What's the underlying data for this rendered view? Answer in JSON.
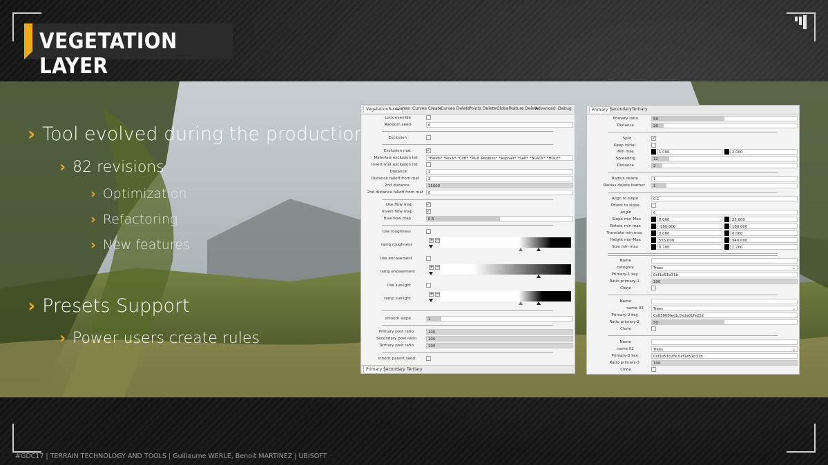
{
  "slide": {
    "title": "VEGETATION LAYER",
    "accent_color": "#f0a81e",
    "footer": "#GDC17 | TERRAIN TECHNOLOGY AND TOOLS | Guillaume WERLE, Benoit MARTINEZ | UBISOFT",
    "bullets": [
      {
        "level": 1,
        "text": "Tool evolved during the production"
      },
      {
        "level": 2,
        "text": "82 revisions"
      },
      {
        "level": 3,
        "text": "Optimization"
      },
      {
        "level": 3,
        "text": "Refactoring"
      },
      {
        "level": 3,
        "text": "New features"
      },
      {
        "level": 1,
        "text": "Presets Support"
      },
      {
        "level": 2,
        "text": "Power users create rules"
      }
    ]
  },
  "left_panel": {
    "tabs": [
      "VegetationRules",
      "Lianas",
      "Curves Create",
      "Curves Delete",
      "Points Delete",
      "GlobalNature Delete",
      "Advanced",
      "Debug"
    ],
    "active_tab": "VegetationRules",
    "bottom_tabs": [
      "Primary",
      "Secondary",
      "Tertiary"
    ],
    "active_bottom_tab": "Primary",
    "lock_override": "Lock override",
    "random_seed": {
      "label": "Random seed",
      "value": "0"
    },
    "exclusion": "Exclusion",
    "exclusion_mat": "Exclusion mat",
    "materials_exclusion_list": {
      "label": "Materials exclusion list",
      "value": "*Fields* *Rock* *Cliff* *Mud_Pebbles* *Asphalt* *Salt* *BLACK* *HOLE*"
    },
    "invert_mat_exclusion_list": "Invert mat exclusion list",
    "distance": {
      "label": "Distance",
      "value": "2"
    },
    "distance_falloff": {
      "label": "Distance falloff from mat",
      "value": "3"
    },
    "second_distance": {
      "label": "2nd distance",
      "value": "15000"
    },
    "second_distance_falloff": {
      "label": "2nd distance falloff from mat",
      "value": "0"
    },
    "use_flow_map": "Use flow map",
    "invert_flow_map": "Invert flow map",
    "bias_flow_map": {
      "label": "Bias flow map",
      "value": "0.5",
      "fraction": 0.5
    },
    "use_roughness": "Use roughness",
    "ramp_roughness": "ramp roughness",
    "use_encasement": "Use encasement",
    "ramp_encasement": "ramp encasement",
    "use_sunlight": "Use sunlight",
    "ramp_sunlight": "ramp sunlight",
    "smooth_slope": {
      "label": "smooth slope",
      "value": "1",
      "fraction": 0.1
    },
    "primary_post_ratio": {
      "label": "Primary post ratio",
      "value": "100"
    },
    "secondary_post_ratio": {
      "label": "Secondary post ratio",
      "value": "100"
    },
    "tertiary_post_ratio": {
      "label": "Tertiary post ratio",
      "value": "100"
    },
    "inherit_parent_seed": "Inherit parent seed"
  },
  "right_panel": {
    "tabs": [
      "Primary",
      "Secondary",
      "Tertiary"
    ],
    "active_tab": "Primary",
    "primary_ratio": {
      "label": "Primary ratio",
      "value": "50",
      "fraction": 0.5
    },
    "distance_top": {
      "label": "Distance",
      "value": "20",
      "fraction": 0.08
    },
    "split": "Split",
    "keep_initial": "Keep initial",
    "min_max": {
      "label": "Min max",
      "min": "1.000",
      "max": "2.000"
    },
    "spreading": {
      "label": "Spreading",
      "value": "12",
      "fraction": 0.12
    },
    "distance2": {
      "label": "Distance",
      "value": "2",
      "fraction": 0.07
    },
    "radius_delete": {
      "label": "Radius delete",
      "value": "1"
    },
    "radius_delete_feather": {
      "label": "Radius delete feather",
      "value": "1",
      "fraction": 0.1
    },
    "align_to_slope": {
      "label": "Align to slope",
      "value": "0.1"
    },
    "orient_to_slope": "Orient to slope",
    "angle": {
      "label": "angle",
      "value": "0"
    },
    "slope_min_max": {
      "label": "Slope min-Max",
      "min": "0.000",
      "max": "25.000"
    },
    "rotate_min_max": {
      "label": "Rotate min max",
      "min": "-180.000",
      "max": "180.000"
    },
    "translate_min_max": {
      "label": "Translate min max",
      "min": "0.000",
      "max": "0.000"
    },
    "height_min_max": {
      "label": "Height min-Max",
      "min": "555.000",
      "max": "940.000"
    },
    "size_min_max": {
      "label": "Size min max",
      "min": "0.700",
      "max": "1.200"
    },
    "name_label": "Name",
    "category": {
      "label": "category",
      "value": "Trees"
    },
    "primary1_key": {
      "label": "Primary-1 key",
      "value": "0xf1e51b31b"
    },
    "ratio_primary1": {
      "label": "Ratio primary-1",
      "value": "100"
    },
    "clone_label": "Clone",
    "name01": {
      "label": "name 01",
      "value": "Trees"
    },
    "primary2_key": {
      "label": "Primary-2 key",
      "value": "0x83868fedb.0xda0bfe252"
    },
    "ratio_primary2": {
      "label": "Ratio primary-2",
      "value": "50",
      "fraction": 0.5
    },
    "name02": {
      "label": "name 02",
      "value": "Trees"
    },
    "primary3_key": {
      "label": "Primary-3 key",
      "value": "0xf1e51b2fe.0xf1e51b31b"
    },
    "ratio_primary3": {
      "label": "Ratio primary-3",
      "value": "100"
    }
  }
}
